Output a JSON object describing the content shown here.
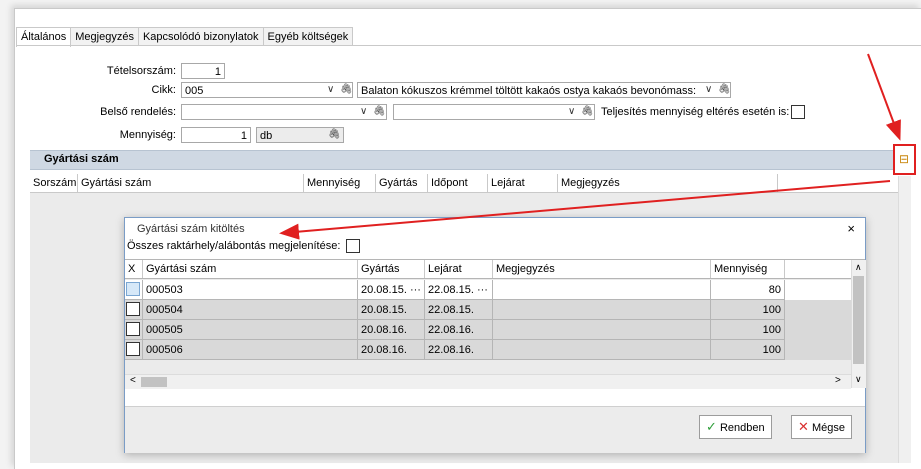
{
  "tabs": [
    "Általános",
    "Megjegyzés",
    "Kapcsolódó bizonylatok",
    "Egyéb költségek"
  ],
  "form": {
    "tetelsorszam_label": "Tételsorszám:",
    "tetelsorszam_value": "1",
    "cikk_label": "Cikk:",
    "cikk_code": "005",
    "cikk_name": "Balaton kókuszos krémmel töltött kakaós ostya kakaós bevonómass:",
    "belso_label": "Belső rendelés:",
    "belso_value1": "",
    "belso_value2": "",
    "teljesites_label": "Teljesítés mennyiség eltérés esetén is:",
    "mennyiseg_label": "Mennyiség:",
    "mennyiseg_value": "1",
    "unit": "db"
  },
  "section": {
    "title": "Gyártási szám"
  },
  "main_grid": {
    "headers": [
      "Sorszám",
      "Gyártási szám",
      "Mennyiség",
      "Gyártás",
      "Időpont",
      "Lejárat",
      "Megjegyzés"
    ]
  },
  "dialog": {
    "title": "Gyártási szám kitöltés",
    "show_all_label": "Összes raktárhely/alábontás megjelenítése:",
    "headers": [
      "X",
      "Gyártási szám",
      "Gyártás",
      "Lejárat",
      "Megjegyzés",
      "Mennyiség"
    ],
    "rows": [
      {
        "serial": "000503",
        "gyartas": "20.08.15.",
        "lejarat": "22.08.15.",
        "megjegyzes": "",
        "mennyiseg": "80",
        "ellipsis": "···"
      },
      {
        "serial": "000504",
        "gyartas": "20.08.15.",
        "lejarat": "22.08.15.",
        "megjegyzes": "",
        "mennyiseg": "100",
        "ellipsis": ""
      },
      {
        "serial": "000505",
        "gyartas": "20.08.16.",
        "lejarat": "22.08.16.",
        "megjegyzes": "",
        "mennyiseg": "100",
        "ellipsis": ""
      },
      {
        "serial": "000506",
        "gyartas": "20.08.16.",
        "lejarat": "22.08.16.",
        "megjegyzes": "",
        "mennyiseg": "100",
        "ellipsis": ""
      }
    ],
    "ok_label": "Rendben",
    "cancel_label": "Mégse"
  },
  "icons": {
    "paperclip": "paperclip-icon",
    "dropdown": "chevron-down-icon",
    "side_button": "layout-split-icon"
  },
  "colors": {
    "section_bg": "#cfd8e3",
    "row_alt_bg": "#d9d9d9",
    "arrow_red": "#e02020",
    "ok_green": "#2e9e3a",
    "cancel_red": "#d93030",
    "selected_check": "#d6e8f8"
  }
}
